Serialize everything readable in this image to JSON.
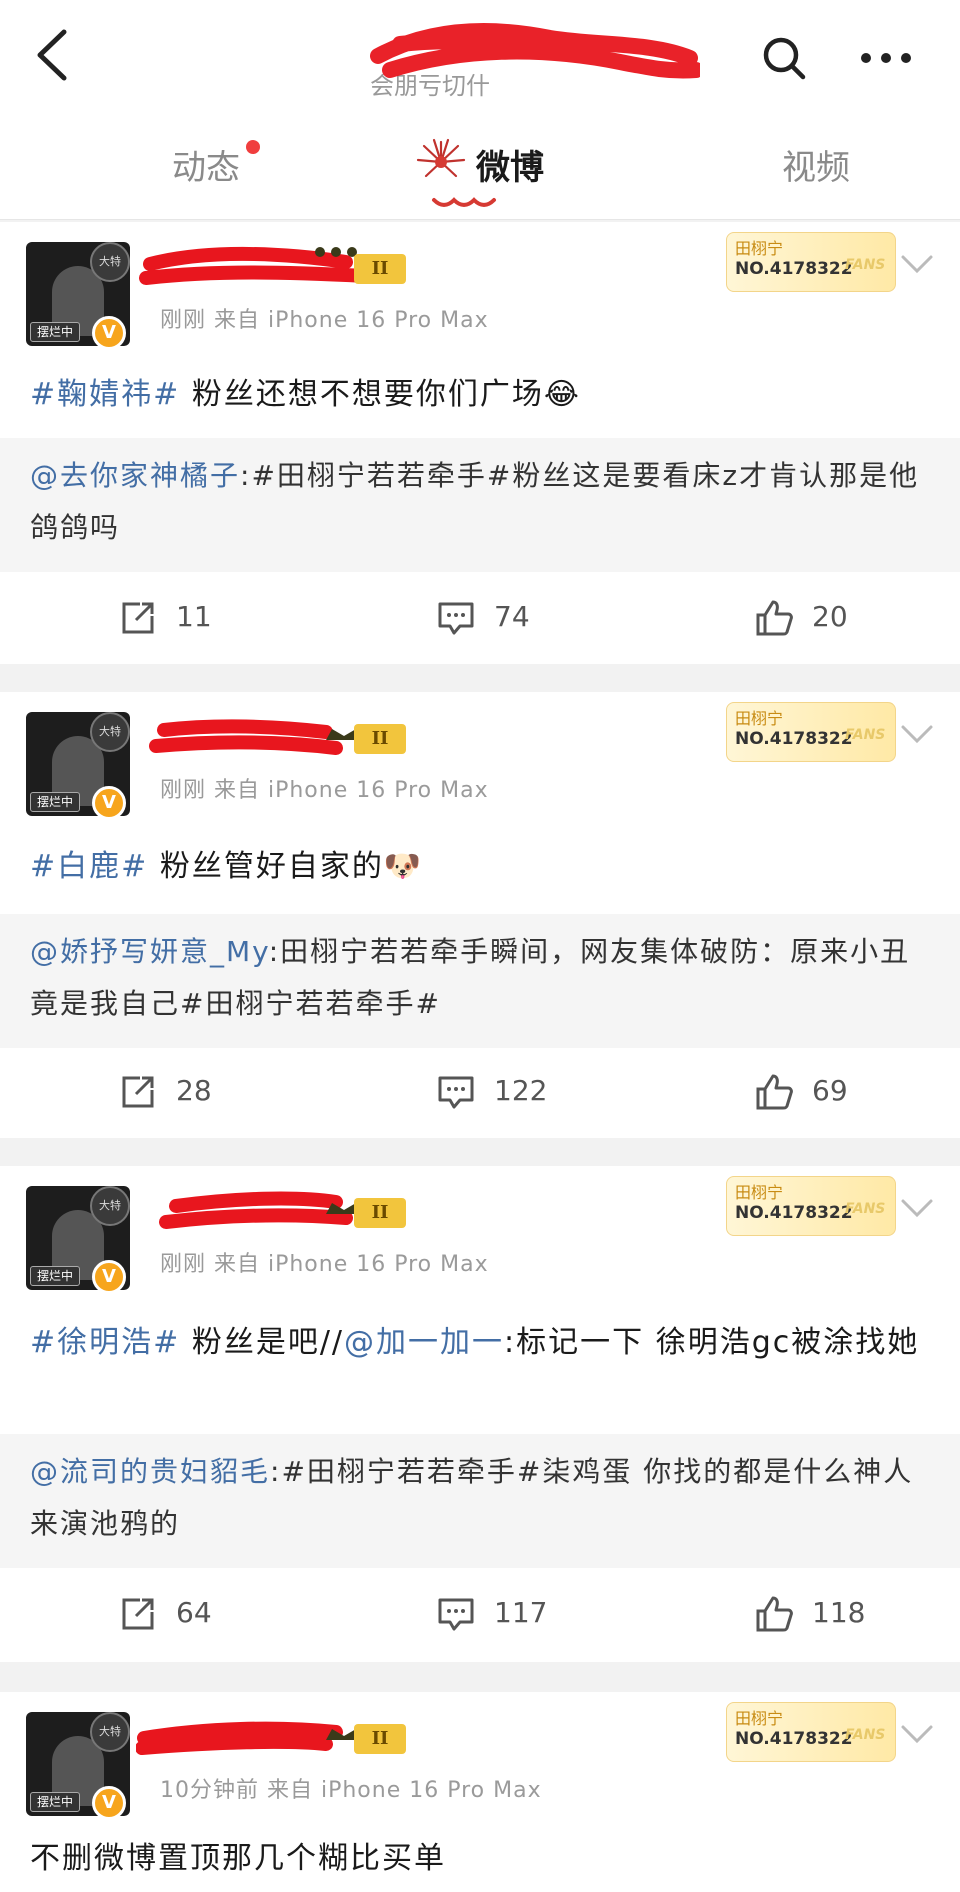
{
  "header": {
    "title_sub": "会朋亏切什",
    "back_icon": "back-arrow-icon",
    "search_icon": "search-icon",
    "more_icon": "more-dots-icon"
  },
  "tabs": [
    {
      "label": "动态",
      "active": false,
      "has_dot": true
    },
    {
      "label": "微博",
      "active": true
    },
    {
      "label": "视频",
      "active": false
    }
  ],
  "fans_badge": {
    "name": "田栩宁",
    "number": "NO.4178322",
    "tag": "FANS"
  },
  "posts": [
    {
      "level": "II",
      "meta": "刚刚  来自 iPhone 16 Pro Max",
      "tag": "#鞠婧祎#",
      "text": " 粉丝还想不想要你们广场😂",
      "repost_user": "@去你家神橘子",
      "repost_text": ":#田栩宁若若牵手#粉丝这是要看床z才肯认那是他鸽鸽吗",
      "shares": "11",
      "comments": "74",
      "likes": "20"
    },
    {
      "level": "II",
      "meta": "刚刚  来自 iPhone 16 Pro Max",
      "tag": "#白鹿#",
      "text": " 粉丝管好自家的🐶",
      "repost_user": "@娇抒写妍意_My",
      "repost_text": ":田栩宁若若牵手瞬间，网友集体破防：原来小丑竟是我自己#田栩宁若若牵手#",
      "shares": "28",
      "comments": "122",
      "likes": "69"
    },
    {
      "level": "II",
      "meta": "刚刚  来自 iPhone 16 Pro Max",
      "tag": "#徐明浩#",
      "text_pre": " 粉丝是吧//",
      "mention": "@加一加一",
      "text_post": ":标记一下 徐明浩gc被涂找她",
      "repost_user": "@流司的贵妇貂毛",
      "repost_text": ":#田栩宁若若牵手#柒鸡蛋 你找的都是什么神人来演池鸦的",
      "shares": "64",
      "comments": "117",
      "likes": "118"
    },
    {
      "level": "II",
      "meta": "10分钟前  来自 iPhone 16 Pro Max",
      "text": "不删微博置顶那几个糊比买单"
    }
  ],
  "colors": {
    "link": "#436ea5",
    "redaction": "#e8161e",
    "badge_gold": "#f2c53d"
  }
}
